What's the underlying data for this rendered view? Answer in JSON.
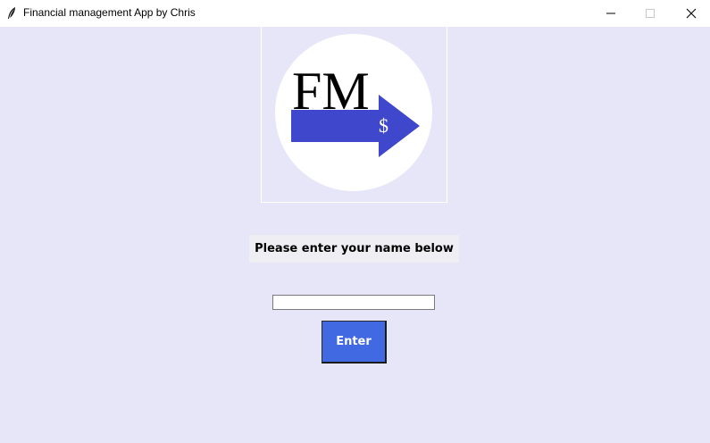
{
  "window": {
    "title": "Financial management App by Chris",
    "controls": {
      "minimize": "minimize-icon",
      "maximize": "maximize-icon",
      "close": "close-icon"
    }
  },
  "logo": {
    "text": "FM",
    "symbol": "$",
    "colors": {
      "circle": "#ffffff",
      "arrow": "#3f48cc",
      "text": "#000000"
    }
  },
  "prompt": {
    "label": "Please enter your name below"
  },
  "name_input": {
    "value": "",
    "placeholder": ""
  },
  "enter_button": {
    "label": "Enter",
    "color": "#4169e1"
  },
  "colors": {
    "background": "#e6e6f8",
    "titlebar": "#ffffff"
  }
}
